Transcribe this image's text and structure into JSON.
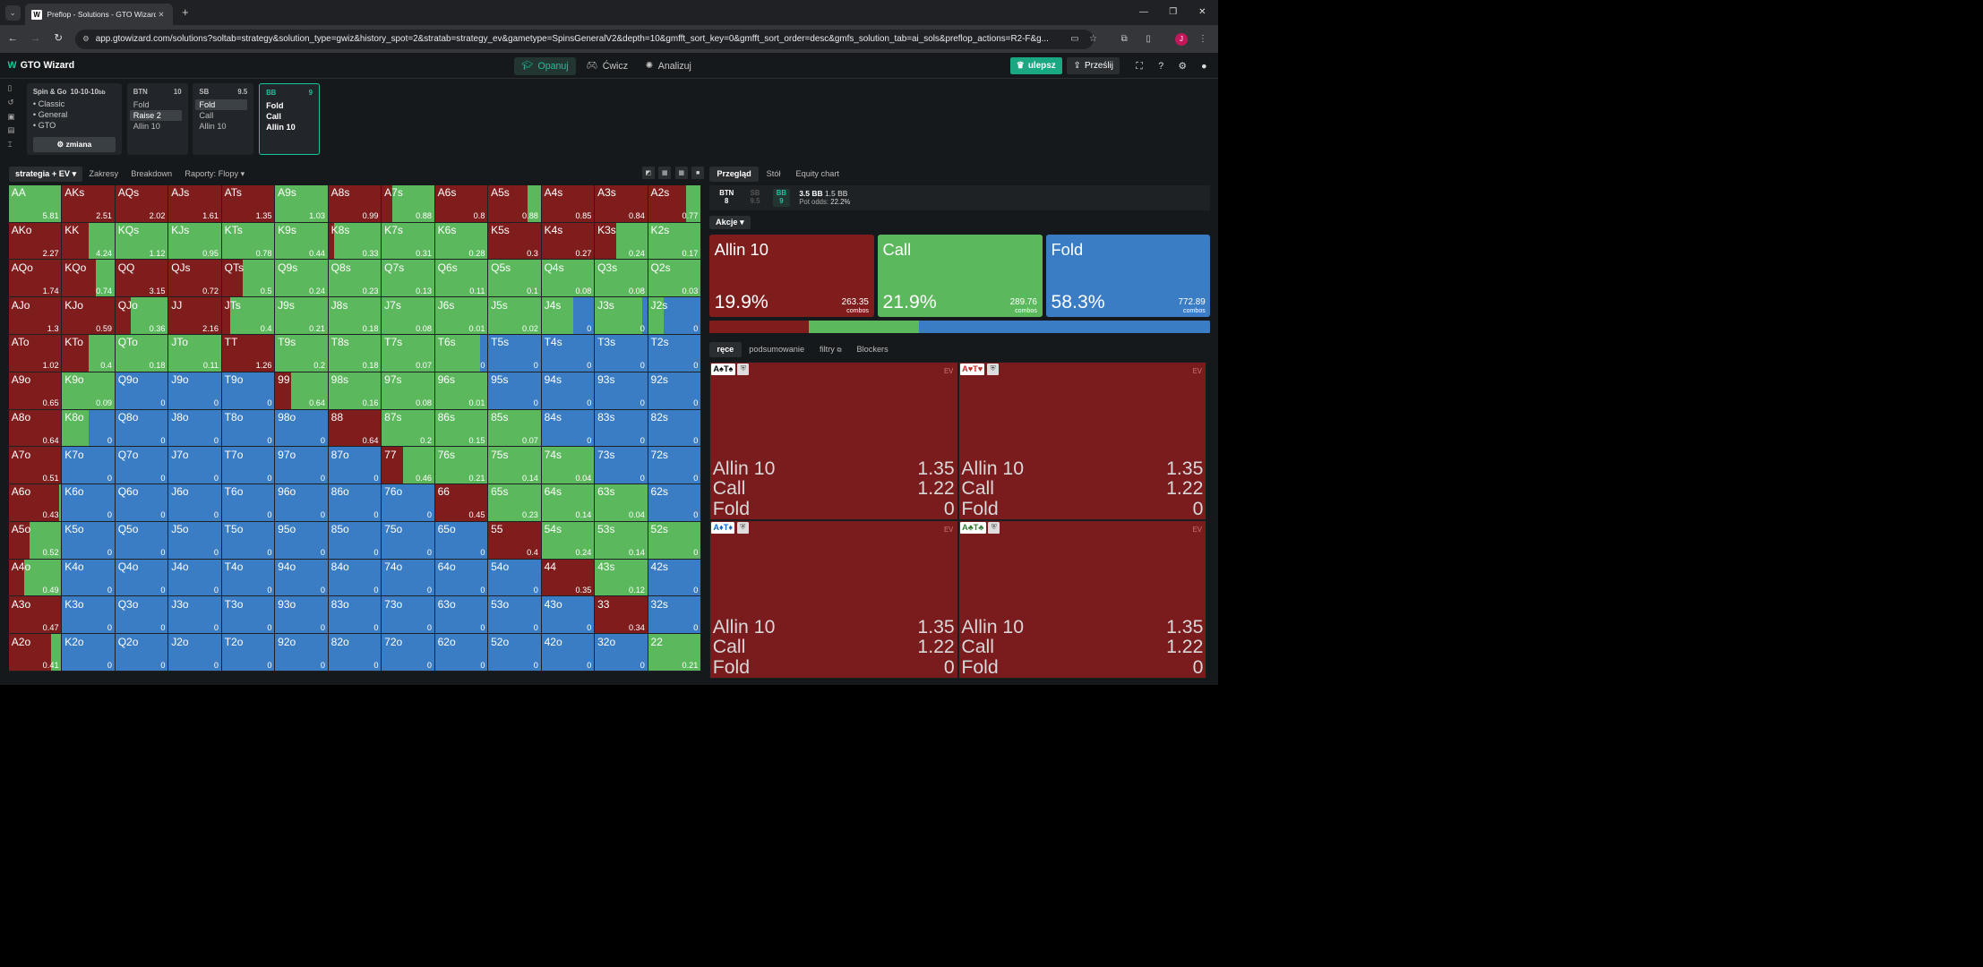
{
  "browser": {
    "tab_title": "Preflop - Solutions - GTO Wizard",
    "favicon": "W",
    "url": "app.gtowizard.com/solutions?soltab=strategy&solution_type=gwiz&history_spot=2&stratab=strategy_ev&gametype=SpinsGeneralV2&depth=10&gmfft_sort_key=0&gmfft_sort_order=desc&gmfs_solution_tab=ai_sols&preflop_actions=R2-F&g...",
    "profile_initial": "J"
  },
  "app": {
    "logo": "GTO Wizard",
    "nav": [
      {
        "label": "Opanuj",
        "icon": "graduation-cap-icon"
      },
      {
        "label": "Ćwicz",
        "icon": "gamepad-icon"
      },
      {
        "label": "Analizuj",
        "icon": "sun-icon"
      }
    ],
    "upgrade": "ulepsz",
    "share": "Prześlij"
  },
  "game": {
    "title": "Spin & Go",
    "stacks": "10-10-10",
    "unit": "bb",
    "items": [
      "Classic",
      "General",
      "GTO"
    ],
    "change": "zmiana"
  },
  "spots": [
    {
      "pos": "BTN",
      "stack": "10",
      "options": [
        "Fold",
        "Raise 2",
        "Allin 10"
      ],
      "selected": 1
    },
    {
      "pos": "SB",
      "stack": "9.5",
      "options": [
        "Fold",
        "Call",
        "Allin 10"
      ],
      "selected": 0
    },
    {
      "pos": "BB",
      "stack": "9",
      "options": [
        "Fold",
        "Call",
        "Allin 10"
      ],
      "selected": -1
    }
  ],
  "left_tabs": [
    "strategia + EV",
    "Zakresy",
    "Breakdown",
    "Raporty: Flopy"
  ],
  "colors": {
    "allin": "#7f1d1d",
    "call": "#5cb85c",
    "fold": "#3a7dc4"
  },
  "matrix": [
    [
      [
        "AA",
        0,
        1,
        0,
        "5.81"
      ],
      [
        "AKs",
        1,
        0,
        0,
        "2.51"
      ],
      [
        "AQs",
        1,
        0,
        0,
        "2.02"
      ],
      [
        "AJs",
        1,
        0,
        0,
        "1.61"
      ],
      [
        "ATs",
        1,
        0,
        0,
        "1.35"
      ],
      [
        "A9s",
        0,
        1,
        0,
        "1.03"
      ],
      [
        "A8s",
        1,
        0,
        0,
        "0.99"
      ],
      [
        "A7s",
        0.2,
        0.8,
        0,
        "0.88"
      ],
      [
        "A6s",
        1,
        0,
        0,
        "0.8"
      ],
      [
        "A5s",
        0.75,
        0.25,
        0,
        "0.88"
      ],
      [
        "A4s",
        1,
        0,
        0,
        "0.85"
      ],
      [
        "A3s",
        1,
        0,
        0,
        "0.84"
      ],
      [
        "A2s",
        0.72,
        0.28,
        0,
        "0.77"
      ]
    ],
    [
      [
        "AKo",
        1,
        0,
        0,
        "2.27"
      ],
      [
        "KK",
        0.5,
        0.5,
        0,
        "4.24"
      ],
      [
        "KQs",
        0,
        1,
        0,
        "1.12"
      ],
      [
        "KJs",
        0,
        1,
        0,
        "0.95"
      ],
      [
        "KTs",
        0,
        1,
        0,
        "0.78"
      ],
      [
        "K9s",
        0,
        1,
        0,
        "0.44"
      ],
      [
        "K8s",
        0.1,
        0.9,
        0,
        "0.33"
      ],
      [
        "K7s",
        0,
        1,
        0,
        "0.31"
      ],
      [
        "K6s",
        0,
        1,
        0,
        "0.28"
      ],
      [
        "K5s",
        1,
        0,
        0,
        "0.3"
      ],
      [
        "K4s",
        1,
        0,
        0,
        "0.27"
      ],
      [
        "K3s",
        0.4,
        0.6,
        0,
        "0.24"
      ],
      [
        "K2s",
        0,
        1,
        0,
        "0.17"
      ]
    ],
    [
      [
        "AQo",
        1,
        0,
        0,
        "1.74"
      ],
      [
        "KQo",
        0.64,
        0.36,
        0,
        "0.74"
      ],
      [
        "QQ",
        1,
        0,
        0,
        "3.15"
      ],
      [
        "QJs",
        1,
        0,
        0,
        "0.72"
      ],
      [
        "QTs",
        0.4,
        0.6,
        0,
        "0.5"
      ],
      [
        "Q9s",
        0,
        1,
        0,
        "0.24"
      ],
      [
        "Q8s",
        0,
        1,
        0,
        "0.23"
      ],
      [
        "Q7s",
        0,
        1,
        0,
        "0.13"
      ],
      [
        "Q6s",
        0,
        1,
        0,
        "0.11"
      ],
      [
        "Q5s",
        0,
        1,
        0,
        "0.1"
      ],
      [
        "Q4s",
        0,
        1,
        0,
        "0.08"
      ],
      [
        "Q3s",
        0,
        1,
        0,
        "0.08"
      ],
      [
        "Q2s",
        0,
        1,
        0,
        "0.03"
      ]
    ],
    [
      [
        "AJo",
        1,
        0,
        0,
        "1.3"
      ],
      [
        "KJo",
        1,
        0,
        0,
        "0.59"
      ],
      [
        "QJo",
        0.3,
        0.7,
        0,
        "0.36"
      ],
      [
        "JJ",
        1,
        0,
        0,
        "2.16"
      ],
      [
        "JTs",
        0.15,
        0.85,
        0,
        "0.4"
      ],
      [
        "J9s",
        0,
        1,
        0,
        "0.21"
      ],
      [
        "J8s",
        0,
        1,
        0,
        "0.18"
      ],
      [
        "J7s",
        0,
        1,
        0,
        "0.08"
      ],
      [
        "J6s",
        0,
        1,
        0,
        "0.01"
      ],
      [
        "J5s",
        0,
        1,
        0,
        "0.02"
      ],
      [
        "J4s",
        0,
        0.6,
        0.4,
        "0"
      ],
      [
        "J3s",
        0,
        0.9,
        0.1,
        "0"
      ],
      [
        "J2s",
        0,
        0.3,
        0.7,
        "0"
      ]
    ],
    [
      [
        "ATo",
        1,
        0,
        0,
        "1.02"
      ],
      [
        "KTo",
        0.5,
        0.5,
        0,
        "0.4"
      ],
      [
        "QTo",
        0,
        1,
        0,
        "0.18"
      ],
      [
        "JTo",
        0,
        1,
        0,
        "0.11"
      ],
      [
        "TT",
        1,
        0,
        0,
        "1.26"
      ],
      [
        "T9s",
        0,
        1,
        0,
        "0.2"
      ],
      [
        "T8s",
        0,
        1,
        0,
        "0.18"
      ],
      [
        "T7s",
        0,
        1,
        0,
        "0.07"
      ],
      [
        "T6s",
        0,
        0.86,
        0.14,
        "0"
      ],
      [
        "T5s",
        0,
        0,
        1,
        "0"
      ],
      [
        "T4s",
        0,
        0,
        1,
        "0"
      ],
      [
        "T3s",
        0,
        0,
        1,
        "0"
      ],
      [
        "T2s",
        0,
        0,
        1,
        "0"
      ]
    ],
    [
      [
        "A9o",
        1,
        0,
        0,
        "0.65"
      ],
      [
        "K9o",
        0,
        1,
        0,
        "0.09"
      ],
      [
        "Q9o",
        0,
        0,
        1,
        "0"
      ],
      [
        "J9o",
        0,
        0,
        1,
        "0"
      ],
      [
        "T9o",
        0,
        0,
        1,
        "0"
      ],
      [
        "99",
        0.3,
        0.7,
        0,
        "0.64"
      ],
      [
        "98s",
        0,
        1,
        0,
        "0.16"
      ],
      [
        "97s",
        0,
        1,
        0,
        "0.08"
      ],
      [
        "96s",
        0,
        1,
        0,
        "0.01"
      ],
      [
        "95s",
        0,
        0,
        1,
        "0"
      ],
      [
        "94s",
        0,
        0,
        1,
        "0"
      ],
      [
        "93s",
        0,
        0,
        1,
        "0"
      ],
      [
        "92s",
        0,
        0,
        1,
        "0"
      ]
    ],
    [
      [
        "A8o",
        1,
        0,
        0,
        "0.64"
      ],
      [
        "K8o",
        0,
        0.5,
        0.5,
        "0"
      ],
      [
        "Q8o",
        0,
        0,
        1,
        "0"
      ],
      [
        "J8o",
        0,
        0,
        1,
        "0"
      ],
      [
        "T8o",
        0,
        0,
        1,
        "0"
      ],
      [
        "98o",
        0,
        0,
        1,
        "0"
      ],
      [
        "88",
        1,
        0,
        0,
        "0.64"
      ],
      [
        "87s",
        0,
        1,
        0,
        "0.2"
      ],
      [
        "86s",
        0,
        1,
        0,
        "0.15"
      ],
      [
        "85s",
        0,
        1,
        0,
        "0.07"
      ],
      [
        "84s",
        0,
        0,
        1,
        "0"
      ],
      [
        "83s",
        0,
        0,
        1,
        "0"
      ],
      [
        "82s",
        0,
        0,
        1,
        "0"
      ]
    ],
    [
      [
        "A7o",
        1,
        0,
        0,
        "0.51"
      ],
      [
        "K7o",
        0,
        0,
        1,
        "0"
      ],
      [
        "Q7o",
        0,
        0,
        1,
        "0"
      ],
      [
        "J7o",
        0,
        0,
        1,
        "0"
      ],
      [
        "T7o",
        0,
        0,
        1,
        "0"
      ],
      [
        "97o",
        0,
        0,
        1,
        "0"
      ],
      [
        "87o",
        0,
        0,
        1,
        "0"
      ],
      [
        "77",
        0.4,
        0.6,
        0,
        "0.46"
      ],
      [
        "76s",
        0,
        1,
        0,
        "0.21"
      ],
      [
        "75s",
        0,
        1,
        0,
        "0.14"
      ],
      [
        "74s",
        0,
        1,
        0,
        "0.04"
      ],
      [
        "73s",
        0,
        0,
        1,
        "0"
      ],
      [
        "72s",
        0,
        0,
        1,
        "0"
      ]
    ],
    [
      [
        "A6o",
        0.96,
        0.04,
        0,
        "0.43"
      ],
      [
        "K6o",
        0,
        0,
        1,
        "0"
      ],
      [
        "Q6o",
        0,
        0,
        1,
        "0"
      ],
      [
        "J6o",
        0,
        0,
        1,
        "0"
      ],
      [
        "T6o",
        0,
        0,
        1,
        "0"
      ],
      [
        "96o",
        0,
        0,
        1,
        "0"
      ],
      [
        "86o",
        0,
        0,
        1,
        "0"
      ],
      [
        "76o",
        0,
        0,
        1,
        "0"
      ],
      [
        "66",
        1,
        0,
        0,
        "0.45"
      ],
      [
        "65s",
        0,
        1,
        0,
        "0.23"
      ],
      [
        "64s",
        0,
        1,
        0,
        "0.14"
      ],
      [
        "63s",
        0,
        1,
        0,
        "0.04"
      ],
      [
        "62s",
        0,
        0,
        1,
        "0"
      ]
    ],
    [
      [
        "A5o",
        0.4,
        0.6,
        0,
        "0.52"
      ],
      [
        "K5o",
        0,
        0,
        1,
        "0"
      ],
      [
        "Q5o",
        0,
        0,
        1,
        "0"
      ],
      [
        "J5o",
        0,
        0,
        1,
        "0"
      ],
      [
        "T5o",
        0,
        0,
        1,
        "0"
      ],
      [
        "95o",
        0,
        0,
        1,
        "0"
      ],
      [
        "85o",
        0,
        0,
        1,
        "0"
      ],
      [
        "75o",
        0,
        0,
        1,
        "0"
      ],
      [
        "65o",
        0,
        0,
        1,
        "0"
      ],
      [
        "55",
        1,
        0,
        0,
        "0.4"
      ],
      [
        "54s",
        0,
        1,
        0,
        "0.24"
      ],
      [
        "53s",
        0,
        1,
        0,
        "0.14"
      ],
      [
        "52s",
        0,
        1,
        0,
        "0"
      ]
    ],
    [
      [
        "A4o",
        0.3,
        0.7,
        0,
        "0.49"
      ],
      [
        "K4o",
        0,
        0,
        1,
        "0"
      ],
      [
        "Q4o",
        0,
        0,
        1,
        "0"
      ],
      [
        "J4o",
        0,
        0,
        1,
        "0"
      ],
      [
        "T4o",
        0,
        0,
        1,
        "0"
      ],
      [
        "94o",
        0,
        0,
        1,
        "0"
      ],
      [
        "84o",
        0,
        0,
        1,
        "0"
      ],
      [
        "74o",
        0,
        0,
        1,
        "0"
      ],
      [
        "64o",
        0,
        0,
        1,
        "0"
      ],
      [
        "54o",
        0,
        0,
        1,
        "0"
      ],
      [
        "44",
        1,
        0,
        0,
        "0.35"
      ],
      [
        "43s",
        0,
        1,
        0,
        "0.12"
      ],
      [
        "42s",
        0,
        0,
        1,
        "0"
      ]
    ],
    [
      [
        "A3o",
        1,
        0,
        0,
        "0.47"
      ],
      [
        "K3o",
        0,
        0,
        1,
        "0"
      ],
      [
        "Q3o",
        0,
        0,
        1,
        "0"
      ],
      [
        "J3o",
        0,
        0,
        1,
        "0"
      ],
      [
        "T3o",
        0,
        0,
        1,
        "0"
      ],
      [
        "93o",
        0,
        0,
        1,
        "0"
      ],
      [
        "83o",
        0,
        0,
        1,
        "0"
      ],
      [
        "73o",
        0,
        0,
        1,
        "0"
      ],
      [
        "63o",
        0,
        0,
        1,
        "0"
      ],
      [
        "53o",
        0,
        0,
        1,
        "0"
      ],
      [
        "43o",
        0,
        0,
        1,
        "0"
      ],
      [
        "33",
        1,
        0,
        0,
        "0.34"
      ],
      [
        "32s",
        0,
        0,
        1,
        "0"
      ]
    ],
    [
      [
        "A2o",
        0.8,
        0.2,
        0,
        "0.41"
      ],
      [
        "K2o",
        0,
        0,
        1,
        "0"
      ],
      [
        "Q2o",
        0,
        0,
        1,
        "0"
      ],
      [
        "J2o",
        0,
        0,
        1,
        "0"
      ],
      [
        "T2o",
        0,
        0,
        1,
        "0"
      ],
      [
        "92o",
        0,
        0,
        1,
        "0"
      ],
      [
        "82o",
        0,
        0,
        1,
        "0"
      ],
      [
        "72o",
        0,
        0,
        1,
        "0"
      ],
      [
        "62o",
        0,
        0,
        1,
        "0"
      ],
      [
        "52o",
        0,
        0,
        1,
        "0"
      ],
      [
        "42o",
        0,
        0,
        1,
        "0"
      ],
      [
        "32o",
        0,
        0,
        1,
        "0"
      ],
      [
        "22",
        0,
        1,
        0,
        "0.21"
      ]
    ]
  ],
  "right_tabs": [
    "Przegląd",
    "Stół",
    "Equity chart"
  ],
  "pot": {
    "players": [
      {
        "pos": "BTN",
        "stack": "8"
      },
      {
        "pos": "SB",
        "stack": "9.5"
      },
      {
        "pos": "BB",
        "stack": "9"
      }
    ],
    "pot": "3.5 BB",
    "call": "1.5 BB",
    "odds_label": "Pot odds:",
    "odds": "22.2%"
  },
  "akcje": "Akcje",
  "actions": [
    {
      "name": "Allin 10",
      "pct": "19.9%",
      "combos": "263.35",
      "combos_label": "combos",
      "freq": 19.9,
      "color": "#7f1d1d"
    },
    {
      "name": "Call",
      "pct": "21.9%",
      "combos": "289.76",
      "combos_label": "combos",
      "freq": 21.9,
      "color": "#5cb85c"
    },
    {
      "name": "Fold",
      "pct": "58.3%",
      "combos": "772.89",
      "combos_label": "combos",
      "freq": 58.2,
      "color": "#3a7dc4"
    }
  ],
  "hand_tabs": [
    "ręce",
    "podsumowanie",
    "filtry",
    "Blockers"
  ],
  "hands": [
    {
      "cards": "A♠T♠",
      "ev_label": "EV",
      "rows": [
        [
          "Allin 10",
          "1.35"
        ],
        [
          "Call",
          "1.22"
        ],
        [
          "Fold",
          "0"
        ]
      ]
    },
    {
      "cards": "A♥T♥",
      "ev_label": "EV",
      "rows": [
        [
          "Allin 10",
          "1.35"
        ],
        [
          "Call",
          "1.22"
        ],
        [
          "Fold",
          "0"
        ]
      ]
    },
    {
      "cards": "A♦T♦",
      "ev_label": "EV",
      "rows": [
        [
          "Allin 10",
          "1.35"
        ],
        [
          "Call",
          "1.22"
        ],
        [
          "Fold",
          "0"
        ]
      ]
    },
    {
      "cards": "A♣T♣",
      "ev_label": "EV",
      "rows": [
        [
          "Allin 10",
          "1.35"
        ],
        [
          "Call",
          "1.22"
        ],
        [
          "Fold",
          "0"
        ]
      ]
    }
  ]
}
